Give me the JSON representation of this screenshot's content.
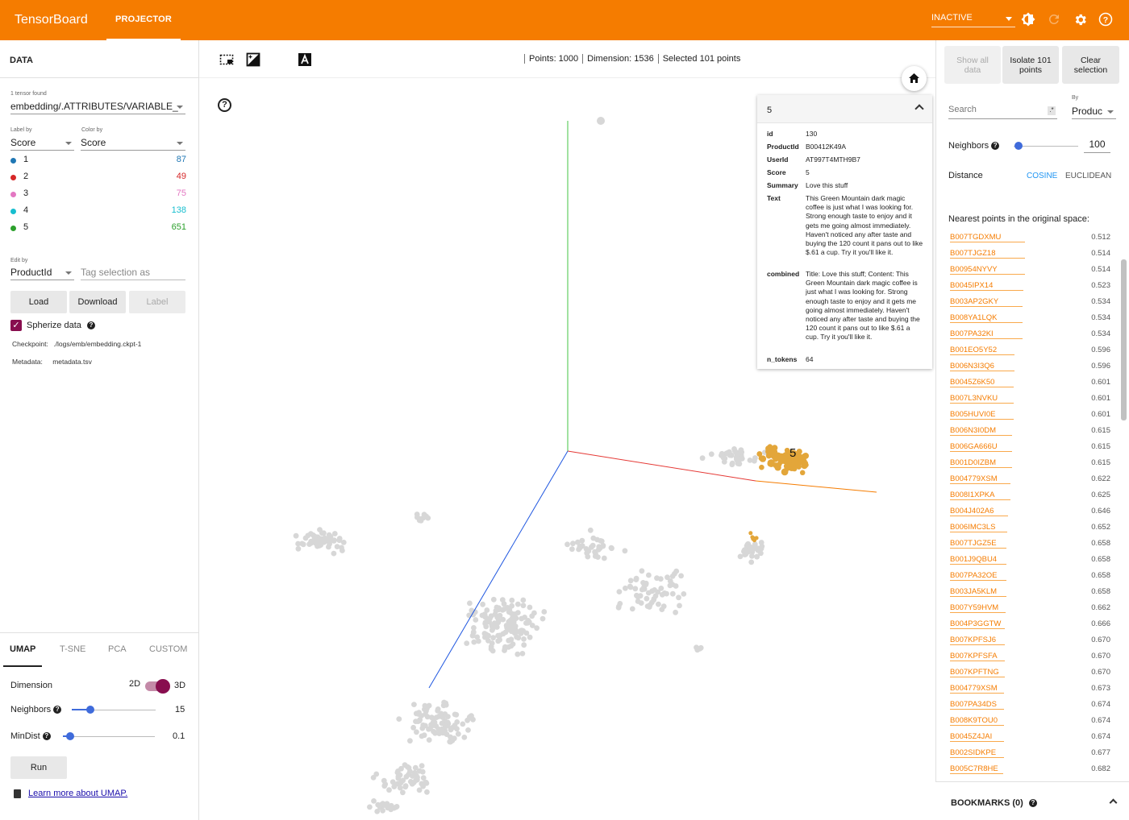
{
  "topbar": {
    "brand": "TensorBoard",
    "tab": "PROJECTOR",
    "run_status": "INACTIVE",
    "icons": [
      "brightness-icon",
      "refresh-icon",
      "settings-icon",
      "help-icon"
    ]
  },
  "left": {
    "title": "DATA",
    "tensor_found": "1 tensor found",
    "tensor_name": "embedding/.ATTRIBUTES/VARIABLE_",
    "label_by_caption": "Label by",
    "label_by": "Score",
    "color_by_caption": "Color by",
    "color_by": "Score",
    "legend": [
      {
        "label": "1",
        "count": "87",
        "color": "#1f77b4"
      },
      {
        "label": "2",
        "count": "49",
        "color": "#d62728"
      },
      {
        "label": "3",
        "count": "75",
        "color": "#e377c2"
      },
      {
        "label": "4",
        "count": "138",
        "color": "#17becf"
      },
      {
        "label": "5",
        "count": "651",
        "color": "#2ca02c"
      }
    ],
    "edit_by_caption": "Edit by",
    "edit_by": "ProductId",
    "tag_placeholder": "Tag selection as",
    "load": "Load",
    "download": "Download",
    "label_btn": "Label",
    "spherize": "Spherize data",
    "checkpoint_label": "Checkpoint:",
    "checkpoint": "./logs/emb/embedding.ckpt-1",
    "metadata_label": "Metadata:",
    "metadata": "metadata.tsv",
    "tabs": [
      "UMAP",
      "T-SNE",
      "PCA",
      "CUSTOM"
    ],
    "dimension_label": "Dimension",
    "dim_2d": "2D",
    "dim_3d": "3D",
    "neighbors_label": "Neighbors",
    "neighbors_value": "15",
    "mindist_label": "MinDist",
    "mindist_value": "0.1",
    "run": "Run",
    "learn_more": "Learn more about UMAP."
  },
  "toolbar": {
    "points": "Points: 1000",
    "dimension": "Dimension: 1536",
    "selected": "Selected 101 points"
  },
  "card": {
    "title": "5",
    "rows": [
      {
        "k": "id",
        "v": "130"
      },
      {
        "k": "ProductId",
        "v": "B00412K49A"
      },
      {
        "k": "UserId",
        "v": "AT997T4MTH9B7"
      },
      {
        "k": "Score",
        "v": "5"
      },
      {
        "k": "Summary",
        "v": "Love this stuff"
      },
      {
        "k": "Text",
        "v": "This Green Mountain dark magic coffee is just what I was looking for. Strong enough taste to enjoy and it gets me going almost immediately. Haven't noticed any after taste and buying the 120 count it pans out to like $.61 a cup. Try it you'll like it."
      },
      {
        "k": "combined",
        "v": "Title: Love this stuff; Content: This Green Mountain dark magic coffee is just what I was looking for. Strong enough taste to enjoy and it gets me going almost immediately. Haven't noticed any after taste and buying the 120 count it pans out to like $.61 a cup. Try it you'll like it."
      },
      {
        "k": "n_tokens",
        "v": "64"
      }
    ]
  },
  "right": {
    "show_all": "Show all data",
    "isolate": "Isolate 101 points",
    "clear": "Clear selection",
    "search_placeholder": "Search",
    "regex": ".*",
    "by_caption": "By",
    "by_value": "Produc",
    "neighbors_label": "Neighbors",
    "neighbors_value": "100",
    "distance_label": "Distance",
    "cosine": "COSINE",
    "euclidean": "EUCLIDEAN",
    "nearest_title": "Nearest points in the original space:",
    "nearest": [
      {
        "id": "B007TGDXMU",
        "d": "0.512"
      },
      {
        "id": "B007TJGZ18",
        "d": "0.514"
      },
      {
        "id": "B00954NYVY",
        "d": "0.514"
      },
      {
        "id": "B0045IPX14",
        "d": "0.523"
      },
      {
        "id": "B003AP2GKY",
        "d": "0.534"
      },
      {
        "id": "B008YA1LQK",
        "d": "0.534"
      },
      {
        "id": "B007PA32KI",
        "d": "0.534"
      },
      {
        "id": "B001EO5Y52",
        "d": "0.596"
      },
      {
        "id": "B006N3I3Q6",
        "d": "0.596"
      },
      {
        "id": "B0045Z6K50",
        "d": "0.601"
      },
      {
        "id": "B007L3NVKU",
        "d": "0.601"
      },
      {
        "id": "B005HUVI0E",
        "d": "0.601"
      },
      {
        "id": "B006N3I0DM",
        "d": "0.615"
      },
      {
        "id": "B006GA666U",
        "d": "0.615"
      },
      {
        "id": "B001D0IZBM",
        "d": "0.615"
      },
      {
        "id": "B004779XSM",
        "d": "0.622"
      },
      {
        "id": "B008I1XPKA",
        "d": "0.625"
      },
      {
        "id": "B004J402A6",
        "d": "0.646"
      },
      {
        "id": "B006IMC3LS",
        "d": "0.652"
      },
      {
        "id": "B007TJGZ5E",
        "d": "0.658"
      },
      {
        "id": "B001J9QBU4",
        "d": "0.658"
      },
      {
        "id": "B007PA32OE",
        "d": "0.658"
      },
      {
        "id": "B003JA5KLM",
        "d": "0.658"
      },
      {
        "id": "B007Y59HVM",
        "d": "0.662"
      },
      {
        "id": "B004P3GGTW",
        "d": "0.666"
      },
      {
        "id": "B007KPFSJ6",
        "d": "0.670"
      },
      {
        "id": "B007KPFSFA",
        "d": "0.670"
      },
      {
        "id": "B007KPFTNG",
        "d": "0.670"
      },
      {
        "id": "B004779XSM",
        "d": "0.673"
      },
      {
        "id": "B007PA34DS",
        "d": "0.674"
      },
      {
        "id": "B008K9TOU0",
        "d": "0.674"
      },
      {
        "id": "B0045Z4JAI",
        "d": "0.674"
      },
      {
        "id": "B002SIDKPE",
        "d": "0.677"
      },
      {
        "id": "B005C7R8HE",
        "d": "0.682"
      }
    ],
    "bookmarks": "BOOKMARKS (0)"
  },
  "scatter": {
    "selected_label": "5",
    "colors": {
      "point": "#d7d7d7",
      "selected": "#e3a63a",
      "axis_x": "#e53935",
      "axis_x2": "#f57c00",
      "axis_y": "#43c443",
      "axis_z": "#1e56e0"
    }
  }
}
